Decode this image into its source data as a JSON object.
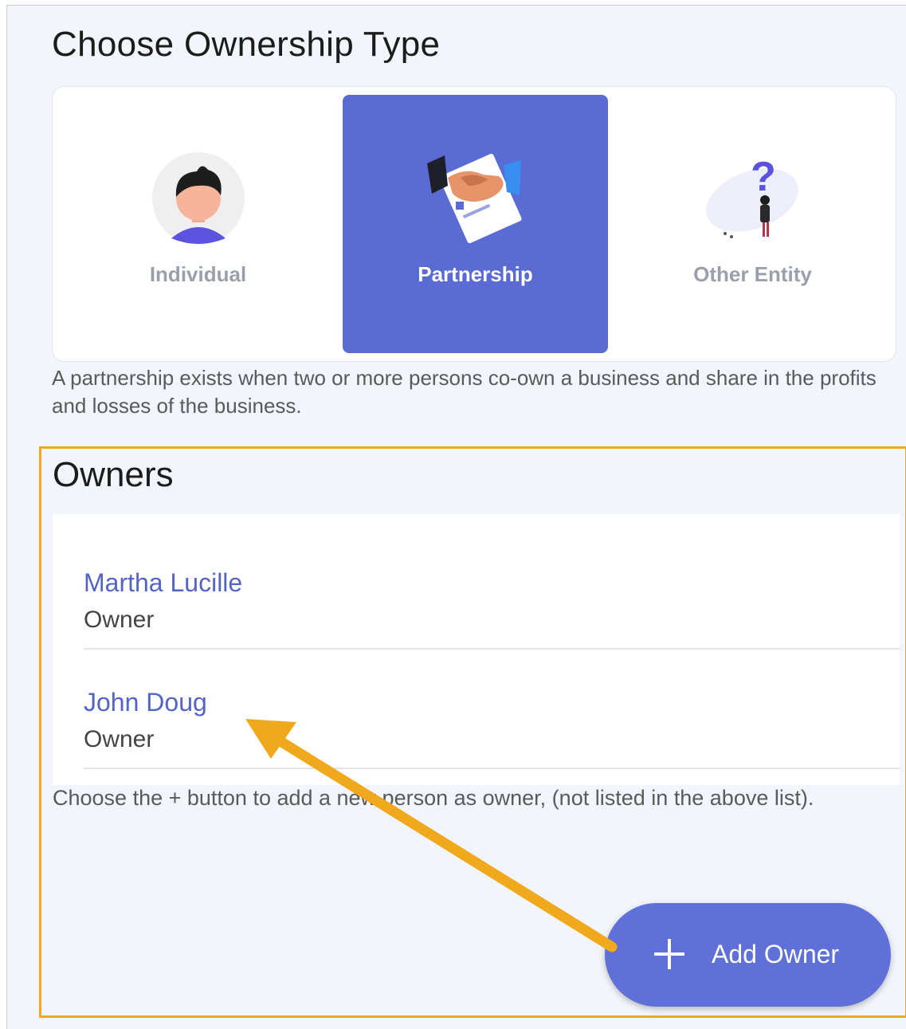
{
  "header": {
    "title": "Choose Ownership Type"
  },
  "ownership_types": [
    {
      "label": "Individual",
      "icon": "person-avatar-icon",
      "selected": false
    },
    {
      "label": "Partnership",
      "icon": "handshake-icon",
      "selected": true
    },
    {
      "label": "Other Entity",
      "icon": "question-person-icon",
      "selected": false
    }
  ],
  "description": "A partnership exists when two or more persons co-own a business and share in the profits and losses of the business.",
  "owners": {
    "title": "Owners",
    "items": [
      {
        "name": "Martha Lucille",
        "role": "Owner"
      },
      {
        "name": "John Doug",
        "role": "Owner"
      }
    ],
    "hint": "Choose the + button to add a new person as owner, (not listed in the above list).",
    "add_button_label": "Add Owner"
  },
  "colors": {
    "accent": "#5a6bd4",
    "highlight_border": "#f0a81d",
    "owner_name": "#5464c6"
  }
}
